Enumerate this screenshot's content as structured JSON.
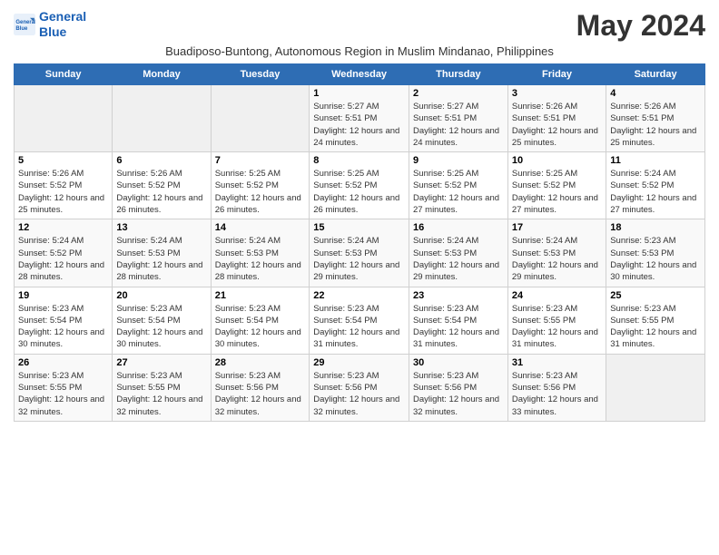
{
  "header": {
    "logo_line1": "General",
    "logo_line2": "Blue",
    "month_year": "May 2024",
    "subtitle": "Buadiposo-Buntong, Autonomous Region in Muslim Mindanao, Philippines"
  },
  "days_of_week": [
    "Sunday",
    "Monday",
    "Tuesday",
    "Wednesday",
    "Thursday",
    "Friday",
    "Saturday"
  ],
  "weeks": [
    [
      {
        "day": "",
        "info": ""
      },
      {
        "day": "",
        "info": ""
      },
      {
        "day": "",
        "info": ""
      },
      {
        "day": "1",
        "info": "Sunrise: 5:27 AM\nSunset: 5:51 PM\nDaylight: 12 hours and 24 minutes."
      },
      {
        "day": "2",
        "info": "Sunrise: 5:27 AM\nSunset: 5:51 PM\nDaylight: 12 hours and 24 minutes."
      },
      {
        "day": "3",
        "info": "Sunrise: 5:26 AM\nSunset: 5:51 PM\nDaylight: 12 hours and 25 minutes."
      },
      {
        "day": "4",
        "info": "Sunrise: 5:26 AM\nSunset: 5:51 PM\nDaylight: 12 hours and 25 minutes."
      }
    ],
    [
      {
        "day": "5",
        "info": "Sunrise: 5:26 AM\nSunset: 5:52 PM\nDaylight: 12 hours and 25 minutes."
      },
      {
        "day": "6",
        "info": "Sunrise: 5:26 AM\nSunset: 5:52 PM\nDaylight: 12 hours and 26 minutes."
      },
      {
        "day": "7",
        "info": "Sunrise: 5:25 AM\nSunset: 5:52 PM\nDaylight: 12 hours and 26 minutes."
      },
      {
        "day": "8",
        "info": "Sunrise: 5:25 AM\nSunset: 5:52 PM\nDaylight: 12 hours and 26 minutes."
      },
      {
        "day": "9",
        "info": "Sunrise: 5:25 AM\nSunset: 5:52 PM\nDaylight: 12 hours and 27 minutes."
      },
      {
        "day": "10",
        "info": "Sunrise: 5:25 AM\nSunset: 5:52 PM\nDaylight: 12 hours and 27 minutes."
      },
      {
        "day": "11",
        "info": "Sunrise: 5:24 AM\nSunset: 5:52 PM\nDaylight: 12 hours and 27 minutes."
      }
    ],
    [
      {
        "day": "12",
        "info": "Sunrise: 5:24 AM\nSunset: 5:52 PM\nDaylight: 12 hours and 28 minutes."
      },
      {
        "day": "13",
        "info": "Sunrise: 5:24 AM\nSunset: 5:53 PM\nDaylight: 12 hours and 28 minutes."
      },
      {
        "day": "14",
        "info": "Sunrise: 5:24 AM\nSunset: 5:53 PM\nDaylight: 12 hours and 28 minutes."
      },
      {
        "day": "15",
        "info": "Sunrise: 5:24 AM\nSunset: 5:53 PM\nDaylight: 12 hours and 29 minutes."
      },
      {
        "day": "16",
        "info": "Sunrise: 5:24 AM\nSunset: 5:53 PM\nDaylight: 12 hours and 29 minutes."
      },
      {
        "day": "17",
        "info": "Sunrise: 5:24 AM\nSunset: 5:53 PM\nDaylight: 12 hours and 29 minutes."
      },
      {
        "day": "18",
        "info": "Sunrise: 5:23 AM\nSunset: 5:53 PM\nDaylight: 12 hours and 30 minutes."
      }
    ],
    [
      {
        "day": "19",
        "info": "Sunrise: 5:23 AM\nSunset: 5:54 PM\nDaylight: 12 hours and 30 minutes."
      },
      {
        "day": "20",
        "info": "Sunrise: 5:23 AM\nSunset: 5:54 PM\nDaylight: 12 hours and 30 minutes."
      },
      {
        "day": "21",
        "info": "Sunrise: 5:23 AM\nSunset: 5:54 PM\nDaylight: 12 hours and 30 minutes."
      },
      {
        "day": "22",
        "info": "Sunrise: 5:23 AM\nSunset: 5:54 PM\nDaylight: 12 hours and 31 minutes."
      },
      {
        "day": "23",
        "info": "Sunrise: 5:23 AM\nSunset: 5:54 PM\nDaylight: 12 hours and 31 minutes."
      },
      {
        "day": "24",
        "info": "Sunrise: 5:23 AM\nSunset: 5:55 PM\nDaylight: 12 hours and 31 minutes."
      },
      {
        "day": "25",
        "info": "Sunrise: 5:23 AM\nSunset: 5:55 PM\nDaylight: 12 hours and 31 minutes."
      }
    ],
    [
      {
        "day": "26",
        "info": "Sunrise: 5:23 AM\nSunset: 5:55 PM\nDaylight: 12 hours and 32 minutes."
      },
      {
        "day": "27",
        "info": "Sunrise: 5:23 AM\nSunset: 5:55 PM\nDaylight: 12 hours and 32 minutes."
      },
      {
        "day": "28",
        "info": "Sunrise: 5:23 AM\nSunset: 5:56 PM\nDaylight: 12 hours and 32 minutes."
      },
      {
        "day": "29",
        "info": "Sunrise: 5:23 AM\nSunset: 5:56 PM\nDaylight: 12 hours and 32 minutes."
      },
      {
        "day": "30",
        "info": "Sunrise: 5:23 AM\nSunset: 5:56 PM\nDaylight: 12 hours and 32 minutes."
      },
      {
        "day": "31",
        "info": "Sunrise: 5:23 AM\nSunset: 5:56 PM\nDaylight: 12 hours and 33 minutes."
      },
      {
        "day": "",
        "info": ""
      }
    ]
  ]
}
